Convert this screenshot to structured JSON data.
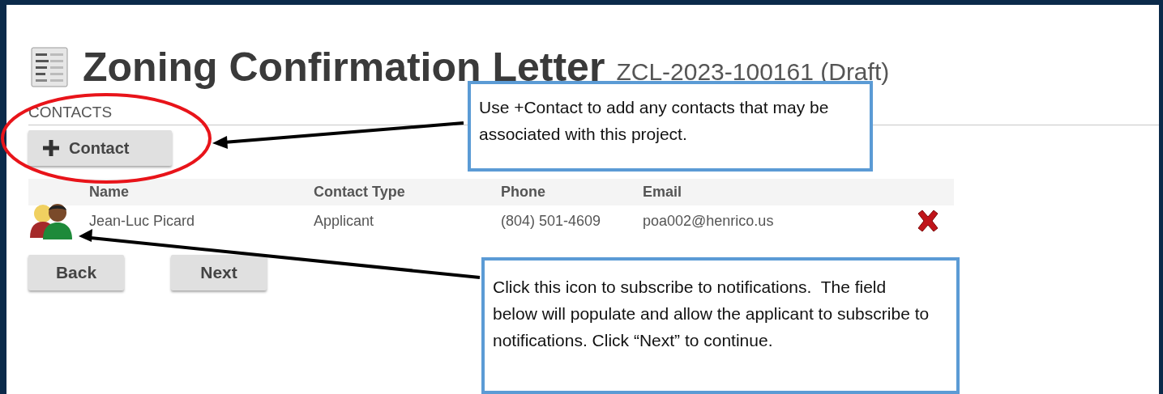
{
  "page": {
    "title": "Zoning Confirmation Letter",
    "record_id": "ZCL-2023-100161 (Draft)"
  },
  "contacts": {
    "heading": "CONTACTS",
    "add_button": "Contact",
    "columns": [
      "Name",
      "Contact Type",
      "Phone",
      "Email"
    ],
    "rows": [
      {
        "name": "Jean-Luc Picard",
        "contact_type": "Applicant",
        "phone": "(804) 501-4609",
        "email": "poa002@henrico.us"
      }
    ]
  },
  "buttons": [
    "Back",
    "Next"
  ],
  "callouts": [
    {
      "text": "Use +Contact to add any contacts that may be associated with this project."
    },
    {
      "text": "Click this icon to subscribe to notifications.  The field below will populate and allow the applicant to subscribe to notifications. Click “Next” to continue."
    }
  ]
}
